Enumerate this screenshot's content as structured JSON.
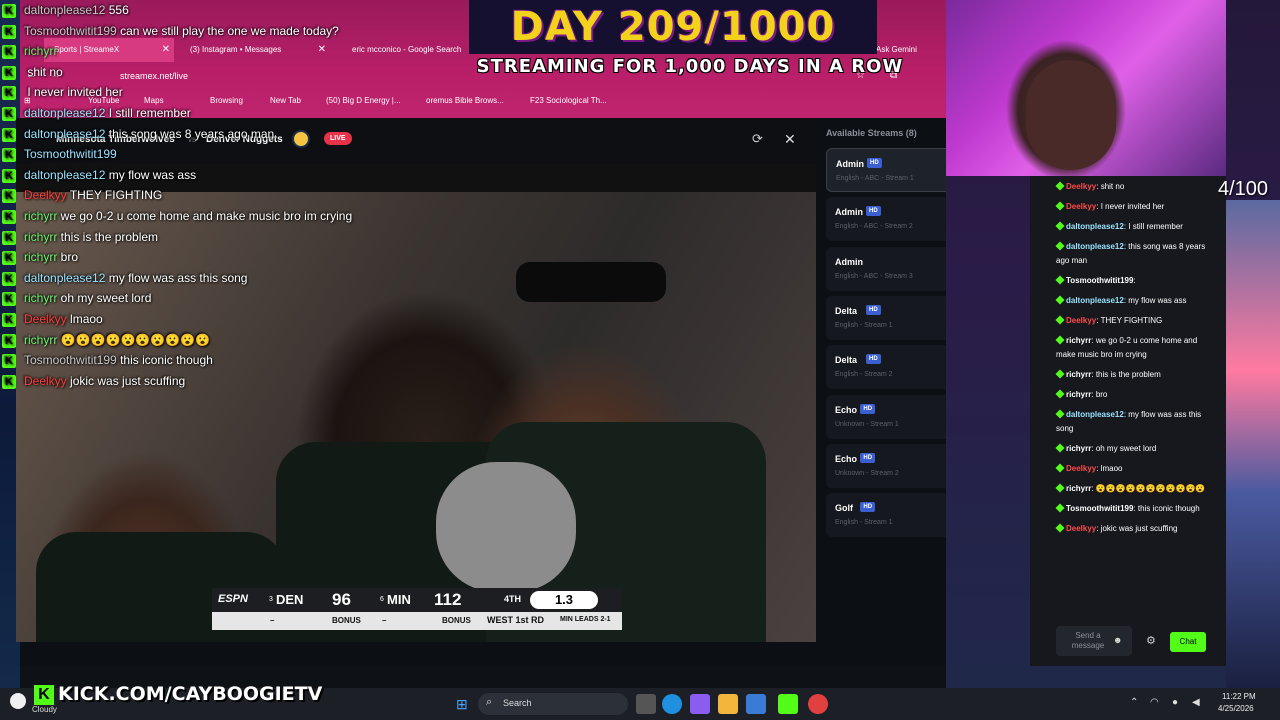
{
  "overlay": {
    "day_title": "DAY 209/1000",
    "streaming_text": "STREAMING FOR 1,000 DAYS IN A ROW",
    "counter": "4/100",
    "kick_url": "KICK.COM/CAYBOOGIETV"
  },
  "overlay_chat": [
    {
      "user": "daltonplease12",
      "msg": "556",
      "style": "grey"
    },
    {
      "user": "Tosmoothwitit199",
      "msg": "can we still play the one we made today?",
      "style": "grey"
    },
    {
      "user": "richyrr",
      "msg": "",
      "style": "green"
    },
    {
      "user": "",
      "msg": "shit no",
      "style": "grey"
    },
    {
      "user": "",
      "msg": "I never invited her",
      "style": "grey"
    },
    {
      "user": "daltonplease12",
      "msg": "I still remember",
      "style": "blue"
    },
    {
      "user": "daltonplease12",
      "msg": "this song was 8 years ago man",
      "style": "blue"
    },
    {
      "user": "Tosmoothwitit199",
      "msg": "",
      "style": "blue"
    },
    {
      "user": "daltonplease12",
      "msg": "my flow was ass",
      "style": "blue"
    },
    {
      "user": "Deelkyy",
      "msg": "THEY FIGHTING",
      "style": "red"
    },
    {
      "user": "richyrr",
      "msg": "we go 0-2 u come home and make music bro im crying",
      "style": "green"
    },
    {
      "user": "richyrr",
      "msg": "this is the problem",
      "style": "green"
    },
    {
      "user": "richyrr",
      "msg": "bro",
      "style": "green"
    },
    {
      "user": "daltonplease12",
      "msg": "my flow was ass this song",
      "style": "blue"
    },
    {
      "user": "richyrr",
      "msg": "oh my sweet lord",
      "style": "green"
    },
    {
      "user": "Deelkyy",
      "msg": "lmaoo",
      "style": "red"
    },
    {
      "user": "richyrr",
      "msg": "😮😮😮😮😮😮😮😮😮😮",
      "style": "green"
    },
    {
      "user": "Tosmoothwitit199",
      "msg": "this iconic though",
      "style": "grey"
    },
    {
      "user": "Deelkyy",
      "msg": "jokic was just scuffing",
      "style": "red"
    }
  ],
  "browser": {
    "tabs": [
      {
        "label": "Sports | StreameX"
      },
      {
        "label": "(3) Instagram • Messages"
      },
      {
        "label": "eric mcconico - Google Search"
      },
      {
        "label": "Ask Gemini"
      }
    ],
    "url": "streamex.net/live",
    "bookmarks": [
      "YouTube",
      "Maps",
      "Browsing",
      "New Tab",
      "(50) Big D Energy |...",
      "oremus Bible Brows...",
      "F23 Sociological Th..."
    ]
  },
  "player": {
    "team_home": "Minnesota Timberwolves",
    "vs": "vs",
    "team_away": "Denver Nuggets",
    "live": "LIVE"
  },
  "scorebug": {
    "network": "ESPN",
    "seed_a": "3",
    "team_a": "DEN",
    "score_a": "96",
    "seed_b": "6",
    "team_b": "MIN",
    "score_b": "112",
    "quarter": "4TH",
    "clock": "1.3",
    "bonus_a": "BONUS",
    "bonus_b": "BONUS",
    "series": "WEST 1st RD",
    "series_status": "MIN LEADS 2-1"
  },
  "streams": {
    "header": "Available Streams (8)",
    "items": [
      {
        "name": "Admin",
        "hd": "HD",
        "sub": "English - ABC - Stream 1"
      },
      {
        "name": "Admin",
        "hd": "HD",
        "sub": "English - ABC - Stream 2"
      },
      {
        "name": "Admin",
        "hd": "",
        "sub": "English - ABC - Stream 3"
      },
      {
        "name": "Delta",
        "hd": "HD",
        "sub": "English - Stream 1"
      },
      {
        "name": "Delta",
        "hd": "HD",
        "sub": "English - Stream 2"
      },
      {
        "name": "Echo",
        "hd": "HD",
        "sub": "Unknown - Stream 1"
      },
      {
        "name": "Echo",
        "hd": "HD",
        "sub": "Unknown - Stream 2"
      },
      {
        "name": "Golf",
        "hd": "HD",
        "sub": "English - Stream 1"
      }
    ]
  },
  "side_chat": {
    "messages": [
      {
        "user": "Deelkyy",
        "msg": "shit no",
        "color": "#ff4a4a"
      },
      {
        "user": "Deelkyy",
        "msg": "I never invited her",
        "color": "#ff4a4a"
      },
      {
        "user": "daltonplease12",
        "msg": "I still remember",
        "color": "#9be3ff"
      },
      {
        "user": "daltonplease12",
        "msg": "this song was 8 years ago man",
        "color": "#9be3ff"
      },
      {
        "user": "Tosmoothwitit199",
        "msg": "",
        "color": "#ffffff"
      },
      {
        "user": "daltonplease12",
        "msg": "my flow was ass",
        "color": "#9be3ff"
      },
      {
        "user": "Deelkyy",
        "msg": "THEY FIGHTING",
        "color": "#ff4a4a"
      },
      {
        "user": "richyrr",
        "msg": "we go 0-2 u come home and make music bro im crying",
        "color": "#ffffff"
      },
      {
        "user": "richyrr",
        "msg": "this is the problem",
        "color": "#ffffff"
      },
      {
        "user": "richyrr",
        "msg": "bro",
        "color": "#ffffff"
      },
      {
        "user": "daltonplease12",
        "msg": "my flow was ass this song",
        "color": "#9be3ff"
      },
      {
        "user": "richyrr",
        "msg": "oh my sweet lord",
        "color": "#ffffff"
      },
      {
        "user": "Deelkyy",
        "msg": "lmaoo",
        "color": "#ff4a4a"
      },
      {
        "user": "richyrr",
        "msg": "😮😮😮😮😮😮😮😮😮😮😮",
        "color": "#ffffff"
      },
      {
        "user": "Tosmoothwitit199",
        "msg": "this iconic though",
        "color": "#ffffff"
      },
      {
        "user": "Deelkyy",
        "msg": "jokic was just scuffing",
        "color": "#ff4a4a"
      }
    ],
    "input_placeholder": "Send a message",
    "chat_button": "Chat"
  },
  "taskbar": {
    "weather": "Cloudy",
    "search": "Search",
    "time": "11:22 PM",
    "date": "4/25/2026"
  },
  "colors": {
    "kick_green": "#53fc18",
    "live_red": "#e6334a",
    "hd_blue": "#3b5fd0",
    "banner_yellow": "#f3d21b"
  }
}
